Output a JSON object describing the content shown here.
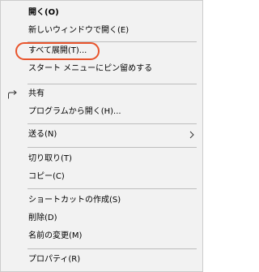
{
  "menu": {
    "items": {
      "open": "開く(O)",
      "open_new_window": "新しいウィンドウで開く(E)",
      "expand_all": "すべて展開(T)...",
      "pin_start": "スタート メニューにピン留めする",
      "share": "共有",
      "open_with": "プログラムから開く(H)...",
      "send_to": "送る(N)",
      "cut": "切り取り(T)",
      "copy": "コピー(C)",
      "create_shortcut": "ショートカットの作成(S)",
      "delete": "削除(D)",
      "rename": "名前の変更(M)",
      "properties": "プロパティ(R)"
    },
    "icons": {
      "share": "share-icon",
      "send_to_submenu": "chevron-right-icon"
    },
    "colors": {
      "highlight_ring": "#e8542c"
    }
  }
}
